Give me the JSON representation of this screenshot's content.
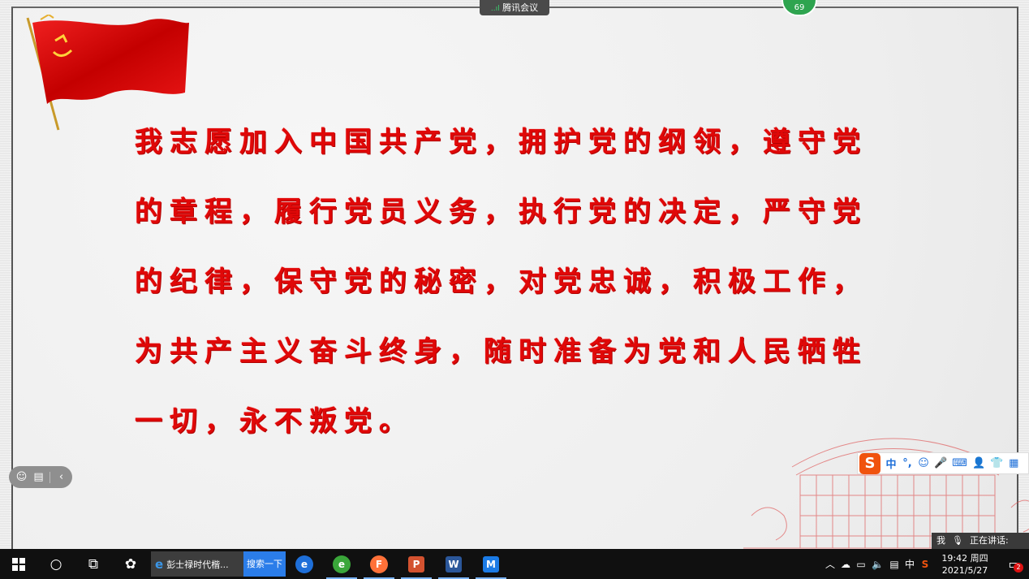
{
  "meeting": {
    "app_name": "腾讯会议",
    "signal": "..ıl",
    "badge_count": "69"
  },
  "slide": {
    "oath_lines": [
      "我志愿加入中国共产党，拥护党的纲领，遵守党",
      "的章程，履行党员义务，执行党的决定，严守党",
      "的纪律，保守党的秘密，对党忠诚，积极工作，",
      "为共产主义奋斗终身，随时准备为党和人民牺牲",
      "一切，永不叛党。"
    ]
  },
  "ime": {
    "logo": "S",
    "items": [
      "中",
      "°,",
      "☺",
      "🎤",
      "⌨",
      "👤",
      "👕",
      "▦"
    ]
  },
  "speaking": {
    "me_label": "我",
    "speaking_label": "正在讲话:"
  },
  "taskbar": {
    "ie_task_title": "彭士禄时代楷...",
    "search_button": "搜索一下",
    "apps": [
      {
        "name": "edge",
        "glyph": "e",
        "color": "#1e6fd9"
      },
      {
        "name": "360-browser",
        "glyph": "e",
        "color": "#3aa63a"
      },
      {
        "name": "firefox",
        "glyph": "F",
        "color": "#ff7139"
      },
      {
        "name": "powerpoint",
        "glyph": "P",
        "color": "#d35230"
      },
      {
        "name": "word",
        "glyph": "W",
        "color": "#2b579a"
      },
      {
        "name": "tencent-meeting",
        "glyph": "M",
        "color": "#1b7be6"
      }
    ],
    "tray": {
      "ime_lang": "中",
      "time": "19:42 周四",
      "date": "2021/5/27",
      "notification_count": "2"
    }
  }
}
